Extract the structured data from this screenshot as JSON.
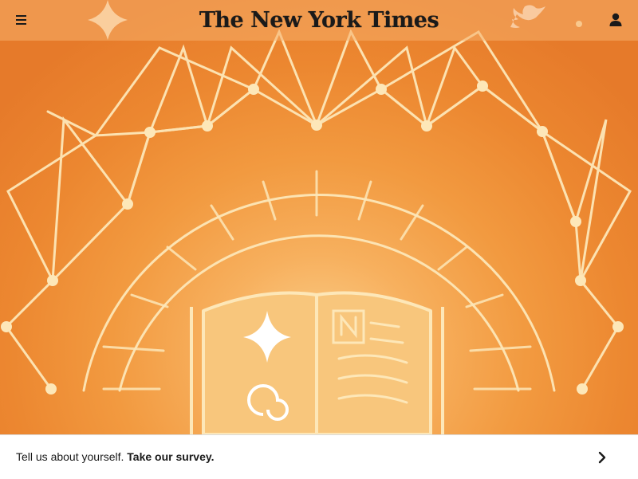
{
  "header": {
    "logo_text": "The New York Times",
    "menu_icon": "hamburger-menu-icon",
    "account_icon": "user-account-icon",
    "background": "#f5af69"
  },
  "hero": {
    "description_icons": [
      "sparkle-star-icon",
      "twitter-bird-icon",
      "open-book-icon",
      "spiral-icon"
    ],
    "accent_light": "#fde7b8",
    "accent_dark": "#e67a2a"
  },
  "survey_banner": {
    "lead_text": "Tell us about yourself.",
    "cta_text": "Take our survey.",
    "arrow_icon": "chevron-right-icon"
  }
}
